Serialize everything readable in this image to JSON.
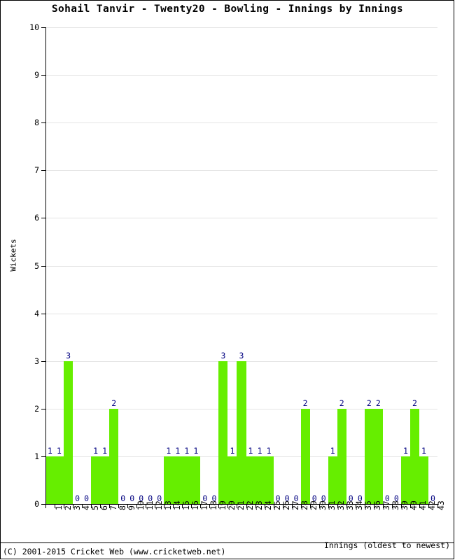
{
  "chart_data": {
    "type": "bar",
    "title": "Sohail Tanvir - Twenty20 - Bowling - Innings by Innings",
    "xlabel": "Innings (oldest to newest)",
    "ylabel": "Wickets",
    "ylim": [
      0,
      10
    ],
    "y_ticks": [
      0,
      1,
      2,
      3,
      4,
      5,
      6,
      7,
      8,
      9,
      10
    ],
    "grid": true,
    "legend": null,
    "bar_color": "#66ee00",
    "value_label_color": "#000080",
    "categories": [
      "1",
      "2",
      "3",
      "4",
      "5",
      "6",
      "7",
      "8",
      "9",
      "10",
      "11",
      "12",
      "13",
      "14",
      "15",
      "16",
      "17",
      "18",
      "19",
      "20",
      "21",
      "22",
      "23",
      "24",
      "25",
      "26",
      "27",
      "28",
      "29",
      "30",
      "31",
      "32",
      "33",
      "34",
      "35",
      "36",
      "37",
      "38",
      "39",
      "40",
      "41",
      "42",
      "43"
    ],
    "values": [
      1,
      1,
      3,
      0,
      0,
      1,
      1,
      2,
      0,
      0,
      0,
      0,
      0,
      1,
      1,
      1,
      1,
      0,
      0,
      3,
      1,
      3,
      1,
      1,
      1,
      0,
      0,
      0,
      2,
      0,
      0,
      1,
      2,
      0,
      0,
      2,
      2,
      0,
      0,
      1,
      2,
      1,
      0
    ]
  },
  "footer": {
    "text": "(C) 2001-2015 Cricket Web (www.cricketweb.net)"
  }
}
